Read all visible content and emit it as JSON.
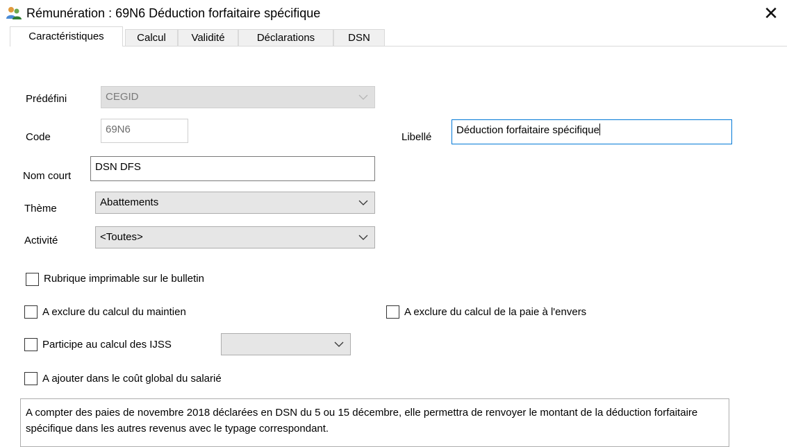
{
  "window": {
    "title": "Rémunération  : 69N6 Déduction forfaitaire spécifique",
    "close_glyph": "✕"
  },
  "tabs": [
    {
      "label": "Caractéristiques",
      "active": true
    },
    {
      "label": "Calcul",
      "active": false
    },
    {
      "label": "Validité",
      "active": false
    },
    {
      "label": "Déclarations",
      "active": false
    },
    {
      "label": "DSN",
      "active": false
    }
  ],
  "form": {
    "predefini": {
      "label": "Prédéfini",
      "value": "CEGID",
      "enabled": false
    },
    "code": {
      "label": "Code",
      "value": "69N6",
      "enabled": false
    },
    "libelle": {
      "label": "Libellé",
      "value": "Déduction forfaitaire spécifique"
    },
    "nom_court": {
      "label": "Nom court",
      "value": "DSN DFS"
    },
    "theme": {
      "label": "Thème",
      "value": "Abattements"
    },
    "activite": {
      "label": "Activité",
      "value": "<Toutes>"
    },
    "ijss": {
      "value": ""
    }
  },
  "checkboxes": {
    "imprimable": {
      "label": "Rubrique imprimable sur le bulletin",
      "checked": false
    },
    "exclure_maintien": {
      "label": "A exclure du calcul du maintien",
      "checked": false
    },
    "exclure_envers": {
      "label": "A exclure du calcul de la paie à l'envers",
      "checked": false
    },
    "ijss": {
      "label": "Participe au calcul des IJSS",
      "checked": false
    },
    "cout_global": {
      "label": "A ajouter dans le coût global du salarié",
      "checked": false
    }
  },
  "memo": {
    "text": "A compter des paies de novembre 2018 déclarées en DSN du 5 ou 15 décembre, elle permettra de renvoyer le montant de la déduction forfaitaire spécifique dans les autres revenus avec le typage correspondant."
  },
  "colors": {
    "focus_border": "#0078d7",
    "combo_bg": "#e6e6e6",
    "tab_border": "#d9d9d9"
  },
  "icons": {
    "app": "users-icon",
    "close": "close-icon",
    "dropdown": "chevron-down-icon"
  }
}
